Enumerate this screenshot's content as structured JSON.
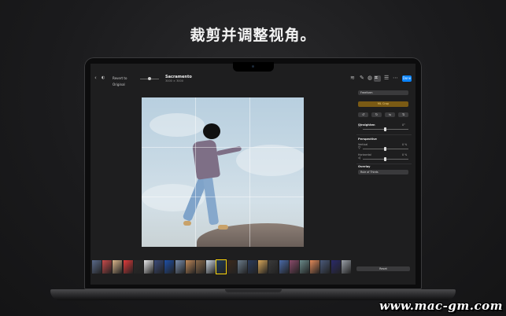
{
  "headline": "裁剪并调整视角。",
  "toolbar": {
    "back_icon": "chevron-left-icon",
    "revert_label": "Revert to Original",
    "file_title": "Sacramento",
    "file_subtitle": "3000 × 3000",
    "done_label": "Done"
  },
  "panel": {
    "aspect_value": "Freeform",
    "auto_label": "ML Crop",
    "straighten_label": "Straighten",
    "straighten_value": "0°",
    "perspective_label": "Perspective",
    "vertical_label": "Vertical",
    "vertical_value": "0 %",
    "horizontal_label": "Horizontal",
    "horizontal_value": "0 %",
    "overlay_label": "Overlay",
    "overlay_value": "Rule of Thirds",
    "reset_label": "Reset"
  },
  "filmstrip": {
    "thumb_colors": [
      "#5a6a8a",
      "#c84a4a",
      "#d9b48a",
      "#e23a3a",
      "#2a2a2a",
      "#e8e8ea",
      "#3a4a7a",
      "#1e4fa8",
      "#7a8fae",
      "#c28a5a",
      "#8a6a4a",
      "#ccd8e4",
      "#1f3a5a",
      "#3c2a1c",
      "#6a7a8a",
      "#2a3a5a",
      "#d7a65a",
      "#3a3a3a",
      "#4a6aa8",
      "#8a4a6a",
      "#6a8a8a",
      "#e28a5a",
      "#4a5a7a",
      "#2a2a6a",
      "#9aa0a8"
    ],
    "selected_index": 12
  },
  "watermark": "www.mac-gm.com",
  "colors": {
    "accent": "#0a84ff",
    "highlight": "#ffd60a",
    "auto_bg": "#7a5a14"
  }
}
